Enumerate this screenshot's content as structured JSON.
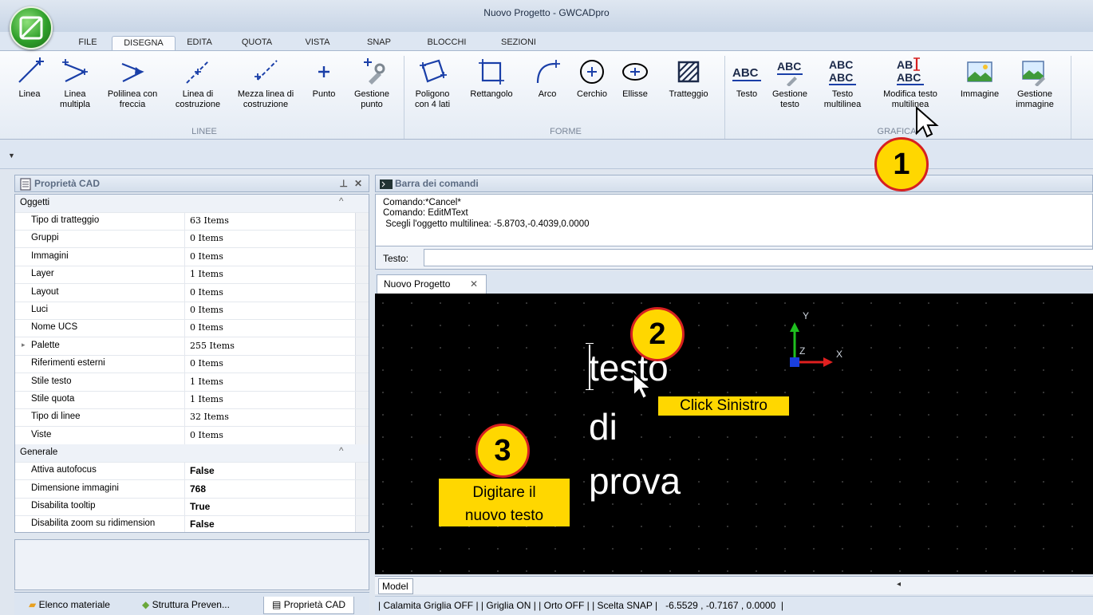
{
  "window": {
    "title": "Nuovo Progetto - GWCADpro"
  },
  "ribbon_tabs": [
    "FILE",
    "DISEGNA",
    "EDITA",
    "QUOTA",
    "VISTA",
    "SNAP",
    "BLOCCHI",
    "SEZIONI"
  ],
  "ribbon": {
    "lines": [
      "Linea",
      "Linea multipla",
      "Polilinea con freccia",
      "Linea di costruzione",
      "Mezza linea di costruzione",
      "Punto",
      "Gestione punto"
    ],
    "shapes": [
      "Poligono con 4 lati",
      "Rettangolo",
      "Arco",
      "Cerchio",
      "Ellisse",
      "Tratteggio"
    ],
    "graphics": [
      "Testo",
      "Gestione testo",
      "Testo multilinea",
      "Modifica testo multilinea",
      "Immagine",
      "Gestione immagine"
    ],
    "groups": {
      "lines": "LINEE",
      "shapes": "FORME",
      "graphics": "GRAFICA"
    }
  },
  "props_panel": {
    "title": "Proprietà CAD"
  },
  "properties": {
    "cat1": "Oggetti",
    "rows1": [
      [
        "Tipo di tratteggio",
        "63 Items"
      ],
      [
        "Gruppi",
        "0 Items"
      ],
      [
        "Immagini",
        "0 Items"
      ],
      [
        "Layer",
        "1 Items"
      ],
      [
        "Layout",
        "0 Items"
      ],
      [
        "Luci",
        "0 Items"
      ],
      [
        "Nome UCS",
        "0 Items"
      ],
      [
        "Palette",
        "255 Items"
      ],
      [
        "Riferimenti esterni",
        "0 Items"
      ],
      [
        "Stile testo",
        "1 Items"
      ],
      [
        "Stile quota",
        "1 Items"
      ],
      [
        "Tipo di linee",
        "32 Items"
      ],
      [
        "Viste",
        "0 Items"
      ]
    ],
    "cat2": "Generale",
    "rows2": [
      [
        "Attiva autofocus",
        "False"
      ],
      [
        "Dimensione immagini",
        "768"
      ],
      [
        "Disabilita tooltip",
        "True"
      ],
      [
        "Disabilita zoom su ridimension",
        "False"
      ]
    ]
  },
  "bottom_tabs": [
    "Elenco materiale",
    "Struttura Preven...",
    "Proprietà CAD"
  ],
  "cmd_panel": {
    "title": "Barra dei comandi",
    "lines": [
      "Comando:*Cancel*",
      "Comando: EditMText",
      " Scegli l'oggetto multilinea: -5.8703,-0.4039,0.0000"
    ],
    "testo_label": "Testo:"
  },
  "doc_tab": "Nuovo Progetto",
  "canvas": {
    "words": [
      "testo",
      "di",
      "prova"
    ],
    "axes": {
      "x": "X",
      "y": "Y",
      "z": "Z"
    }
  },
  "model_tab": "Model",
  "status": "| Calamita Griglia OFF | | Griglia ON | | Orto OFF | | Scelta SNAP |   -6.5529 , -0.7167 , 0.0000  |",
  "annotations": {
    "step1": "1",
    "step2": "2",
    "step3": "3",
    "click": "Click Sinistro",
    "type_line1": "Digitare il",
    "type_line2": "nuovo testo"
  },
  "colors": {
    "badge": "#ffd700",
    "badge_border": "#d62020"
  }
}
